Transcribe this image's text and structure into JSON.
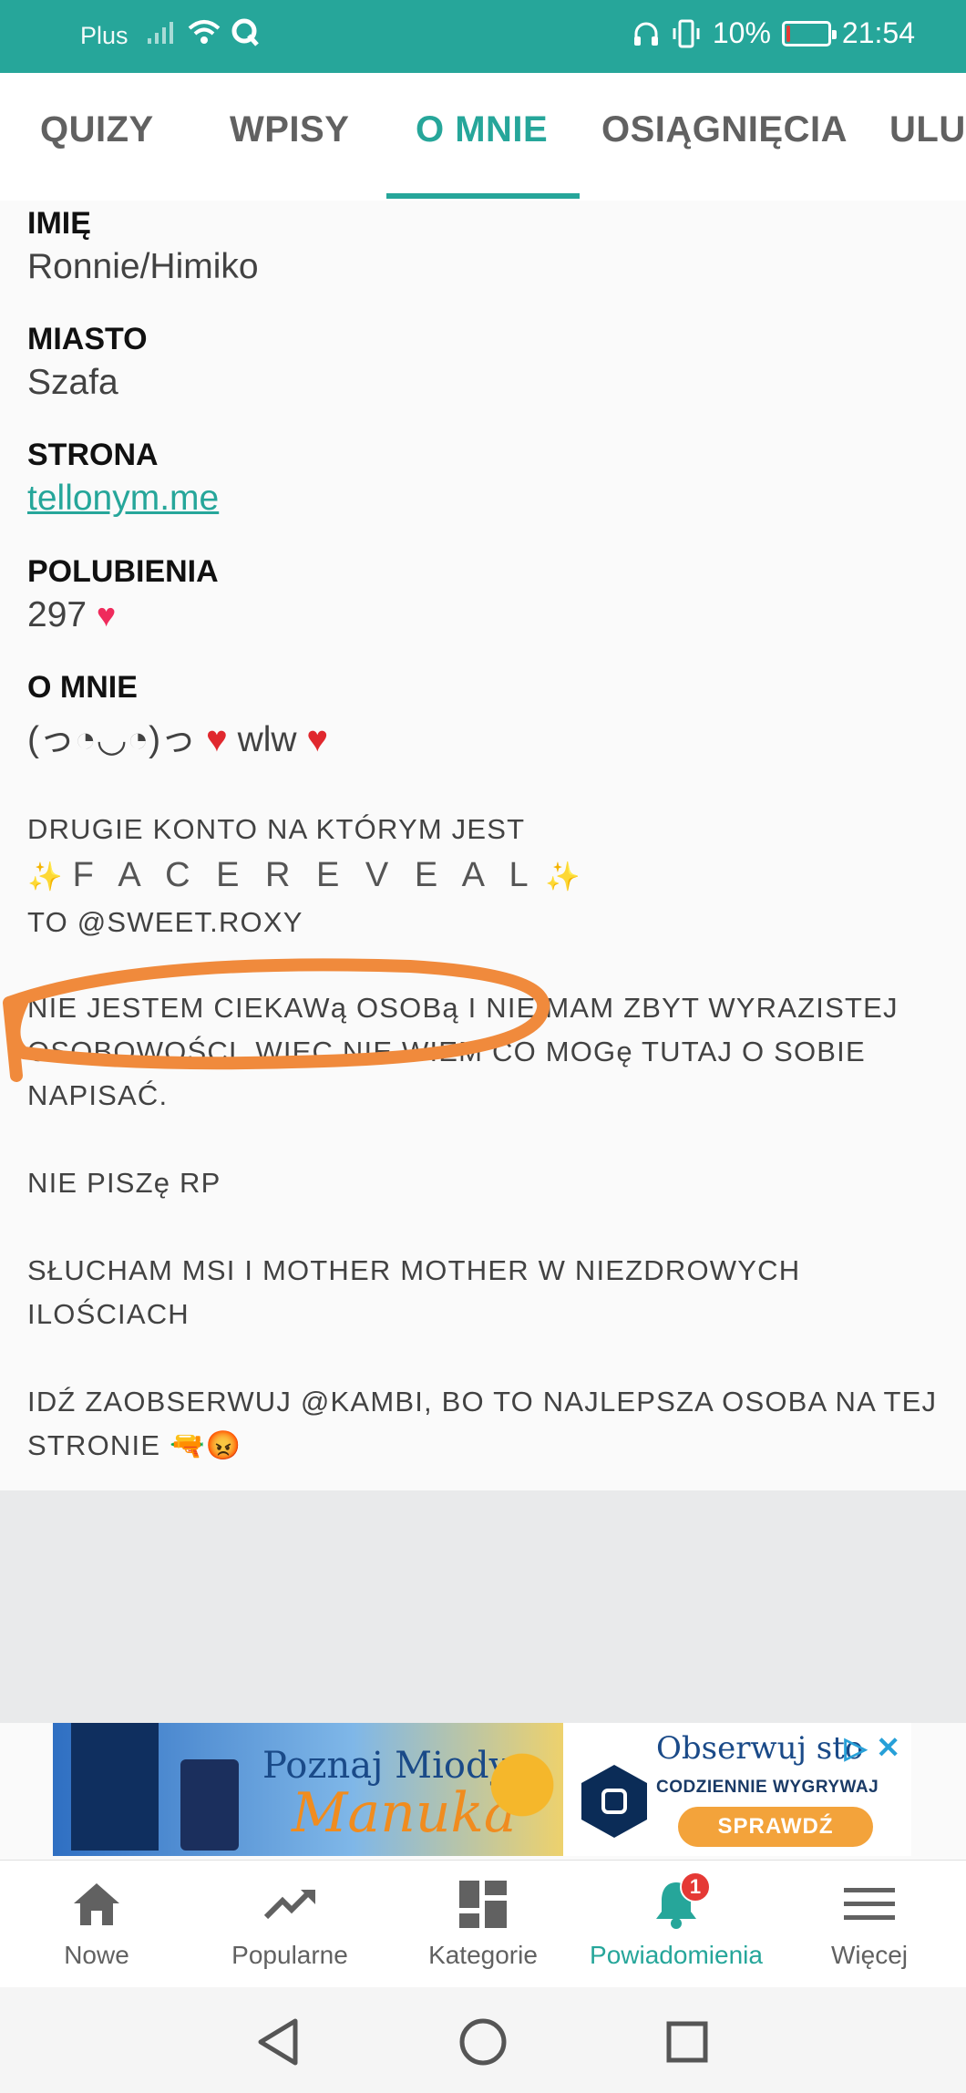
{
  "status_bar": {
    "carrier": "Plus",
    "battery_percent": "10%",
    "time": "21:54",
    "battery_level": 0.1,
    "icons": [
      "signal-icon",
      "wifi-icon",
      "q-app-icon",
      "headphones-icon",
      "vibrate-icon",
      "battery-icon"
    ]
  },
  "tabs": [
    {
      "label": "QUIZY"
    },
    {
      "label": "WPISY"
    },
    {
      "label": "O MNIE"
    },
    {
      "label": "OSIĄGNIĘCIA"
    },
    {
      "label": "ULU"
    }
  ],
  "active_tab": "O MNIE",
  "profile": {
    "name_label": "IMIĘ",
    "name_value": "Ronnie/Himiko",
    "city_label": "MIASTO",
    "city_value": "Szafa",
    "site_label": "STRONA",
    "site_value": "tellonym.me",
    "likes_label": "POLUBIENIA",
    "likes_value": "297",
    "about_label": "O MNIE",
    "about_prefix": "(っ◔◡◔)っ",
    "about_word": "wlw"
  },
  "bio": {
    "line1": "DRUGIE KONTO NA KTÓRYM JEST",
    "face_reveal": "F A C E R E V E A L",
    "line2": "TO @SWEET.ROXY",
    "para2": "NIE JESTEM CIEKAWą OSOBą I NIE MAM ZBYT WYRAZISTEJ OSOBOWOŚCI, WIĘC NIE WIEM CO MOGę TUTAJ O SOBIE NAPISAĆ.",
    "para3": "NIE PISZę RP",
    "para4": "SŁUCHAM MSI I MOTHER MOTHER W NIEZDROWYCH ILOŚCIACH",
    "para5": "IDŹ ZAOBSERWUJ @KAMBI, BO TO NAJLEPSZA OSOBA NA TEJ STRONIE"
  },
  "ad": {
    "title": "Poznaj Miody",
    "subtitle": "Manuka",
    "right_title": "Obserwuj sto",
    "right_sub": "CODZIENNIE WYGRYWAJ",
    "button": "SPRAWDŹ"
  },
  "bottom_nav": [
    {
      "label": "Nowe",
      "icon": "home-icon"
    },
    {
      "label": "Popularne",
      "icon": "trending-icon"
    },
    {
      "label": "Kategorie",
      "icon": "grid-icon"
    },
    {
      "label": "Powiadomienia",
      "icon": "bell-icon",
      "badge": "1"
    },
    {
      "label": "Więcej",
      "icon": "menu-icon"
    }
  ],
  "colors": {
    "accent": "#26a69a",
    "annotation": "#f08a3c",
    "badge": "#e53935"
  }
}
